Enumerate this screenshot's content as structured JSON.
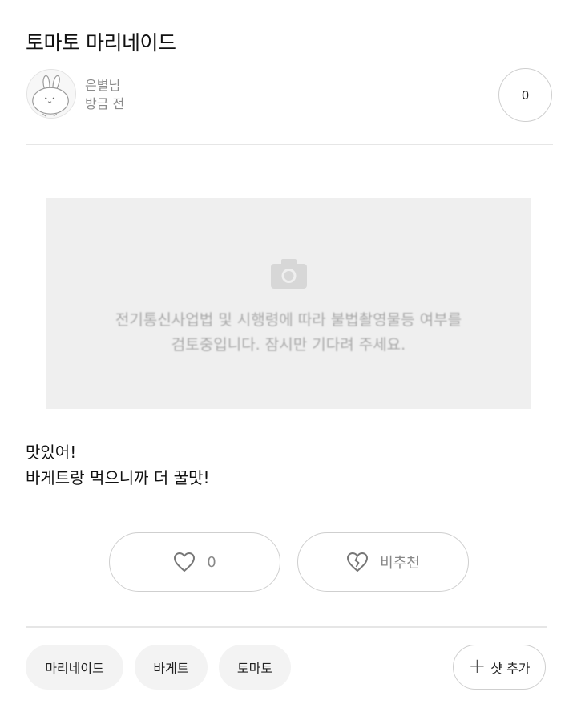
{
  "post": {
    "title": "토마토 마리네이드",
    "author_name": "은별님",
    "time": "방금 전",
    "count": "0",
    "image_notice_line1": "전기통신사업법 및 시행령에 따라 불법촬영물등 여부를",
    "image_notice_line2": "검토중입니다. 잠시만 기다려 주세요.",
    "content_line1": "맛있어!",
    "content_line2": "바게트랑 먹으니까 더 꿀맛!"
  },
  "reactions": {
    "like_count": "0",
    "dislike_label": "비추천"
  },
  "tags": [
    "마리네이드",
    "바게트",
    "토마토"
  ],
  "add_tag_label": "샷 추가",
  "icons": {
    "avatar": "rabbit-avatar-icon",
    "camera": "camera-icon",
    "like": "heart-outline-icon",
    "dislike": "broken-heart-icon",
    "add": "plus-icon"
  }
}
